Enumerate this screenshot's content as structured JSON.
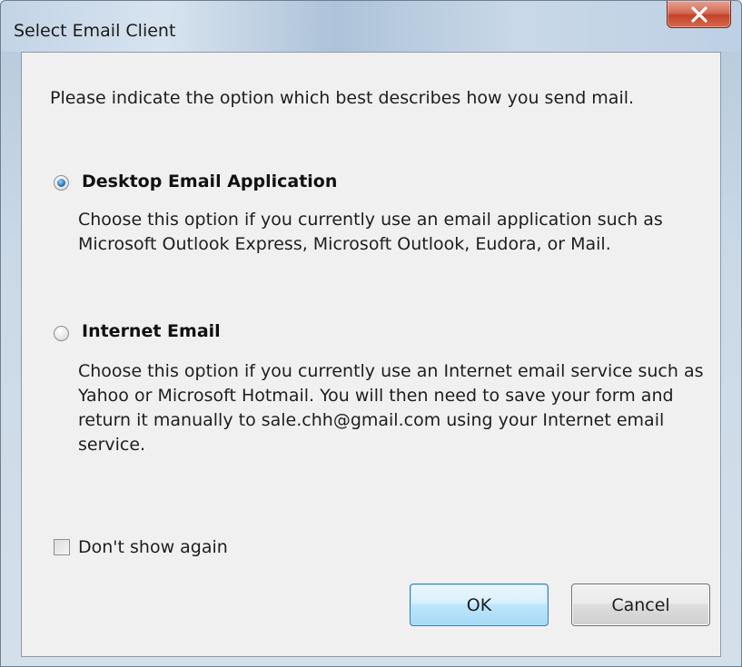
{
  "window": {
    "title": "Select Email Client",
    "close_icon": "close-icon"
  },
  "prompt": "Please indicate the option which best describes how you send mail.",
  "options": [
    {
      "label": "Desktop Email Application",
      "description": "Choose this option if you currently use an email application such as Microsoft Outlook Express, Microsoft Outlook, Eudora, or Mail.",
      "selected": true
    },
    {
      "label": "Internet Email",
      "description": "Choose this option if you currently use an Internet email service such as Yahoo or Microsoft Hotmail. You will then need to save your form and return it manually to sale.chh@gmail.com using your Internet email service.",
      "selected": false
    }
  ],
  "dont_show_again": {
    "label": "Don't show again",
    "checked": false
  },
  "buttons": {
    "ok": "OK",
    "cancel": "Cancel"
  },
  "colors": {
    "close_button": "#c9472f",
    "default_button": "#bee6fd",
    "radio_selected": "#2c7ac2"
  }
}
